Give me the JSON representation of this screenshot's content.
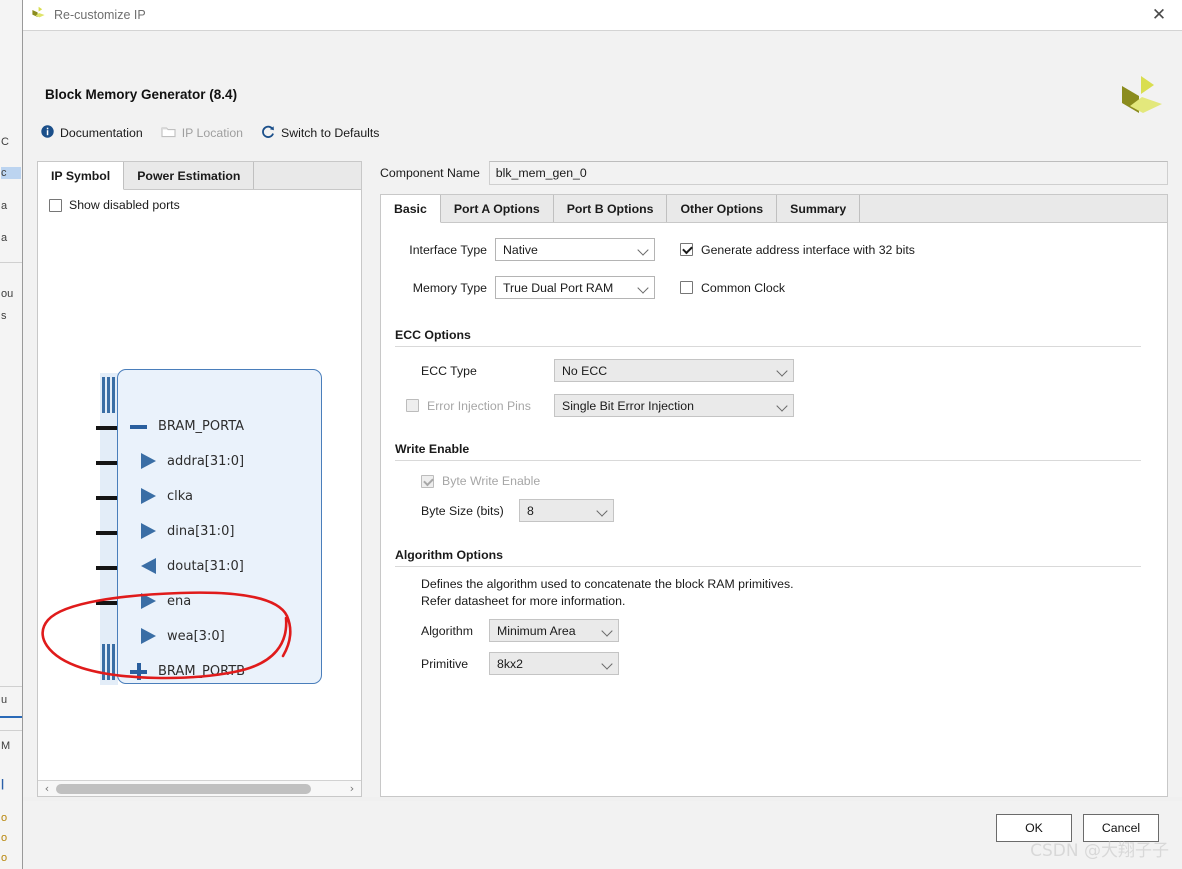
{
  "window": {
    "title": "Re-customize IP",
    "close_label": "✕",
    "app_icon": "xilinx-logo-icon"
  },
  "header": {
    "ip_title": "Block Memory Generator (8.4)",
    "brand_logo": "xilinx-logo-icon"
  },
  "linkbar": [
    {
      "label": "Documentation",
      "icon": "info-icon",
      "enabled": true
    },
    {
      "label": "IP Location",
      "icon": "folder-icon",
      "enabled": false
    },
    {
      "label": "Switch to Defaults",
      "icon": "refresh-icon",
      "enabled": true
    }
  ],
  "left_panel": {
    "tabs": [
      {
        "label": "IP Symbol",
        "active": true
      },
      {
        "label": "Power Estimation",
        "active": false
      }
    ],
    "show_disabled_ports": {
      "label": "Show disabled ports",
      "checked": false
    },
    "symbol": {
      "ports": [
        {
          "label": "BRAM_PORTA",
          "marker": "minus-icon",
          "kind": "bus-expanded"
        },
        {
          "label": "addra[31:0]",
          "marker": "arrow-in-icon",
          "kind": "input"
        },
        {
          "label": "clka",
          "marker": "arrow-in-icon",
          "kind": "input"
        },
        {
          "label": "dina[31:0]",
          "marker": "arrow-in-icon",
          "kind": "input"
        },
        {
          "label": "douta[31:0]",
          "marker": "arrow-out-icon",
          "kind": "output"
        },
        {
          "label": "ena",
          "marker": "arrow-in-icon",
          "kind": "input"
        },
        {
          "label": "wea[3:0]",
          "marker": "arrow-in-icon",
          "kind": "input"
        },
        {
          "label": "BRAM_PORTB",
          "marker": "plus-icon",
          "kind": "bus-collapsed"
        }
      ]
    },
    "scrollbar": {
      "left_arrow": "‹",
      "right_arrow": "›"
    }
  },
  "component_name": {
    "label": "Component Name",
    "value": "blk_mem_gen_0"
  },
  "main_tabs": [
    {
      "label": "Basic",
      "active": true
    },
    {
      "label": "Port A Options",
      "active": false
    },
    {
      "label": "Port B Options",
      "active": false
    },
    {
      "label": "Other Options",
      "active": false
    },
    {
      "label": "Summary",
      "active": false
    }
  ],
  "basic": {
    "interface_type": {
      "label": "Interface Type",
      "value": "Native",
      "enabled": true
    },
    "memory_type": {
      "label": "Memory Type",
      "value": "True Dual Port RAM",
      "enabled": true
    },
    "generate_address_interface": {
      "label": "Generate address interface with 32 bits",
      "checked": true,
      "enabled": true
    },
    "common_clock": {
      "label": "Common Clock",
      "checked": false,
      "enabled": true
    },
    "ecc_options": {
      "title": "ECC Options",
      "ecc_type": {
        "label": "ECC Type",
        "value": "No ECC",
        "enabled": false
      },
      "error_injection_pins": {
        "label": "Error Injection Pins",
        "checked": false,
        "enabled": false,
        "value": "Single Bit Error Injection"
      }
    },
    "write_enable": {
      "title": "Write Enable",
      "byte_write_enable": {
        "label": "Byte Write Enable",
        "checked": true,
        "enabled": false
      },
      "byte_size": {
        "label": "Byte Size (bits)",
        "value": "8",
        "enabled": false
      }
    },
    "algorithm_options": {
      "title": "Algorithm Options",
      "help_line_1": "Defines the algorithm used to concatenate the block RAM primitives.",
      "help_line_2": "Refer datasheet for more information.",
      "algorithm": {
        "label": "Algorithm",
        "value": "Minimum Area",
        "enabled": false
      },
      "primitive": {
        "label": "Primitive",
        "value": "8kx2",
        "enabled": false
      }
    }
  },
  "footer": {
    "ok_label": "OK",
    "cancel_label": "Cancel"
  },
  "watermark": "CSDN @大翔子子",
  "annotation": {
    "type": "hand-drawn-red-ellipse",
    "color": "#e01b1b",
    "targets": [
      "ena",
      "wea[3:0]"
    ]
  },
  "colors": {
    "accent_blue": "#3a6ea5",
    "block_fill": "#eaf2fb",
    "block_border": "#4a7ebb",
    "dialog_bg": "#f2f2f2",
    "annotation_red": "#e01b1b",
    "brand_yellow": "#d9de50",
    "brand_olive": "#8b8c1e"
  },
  "background_fragments": {
    "left_strip": [
      "C",
      "c",
      "a",
      "a",
      "ou",
      "s",
      "u",
      "M",
      "o",
      "o",
      "o"
    ],
    "right_strip_note": "dark-code-editor"
  }
}
